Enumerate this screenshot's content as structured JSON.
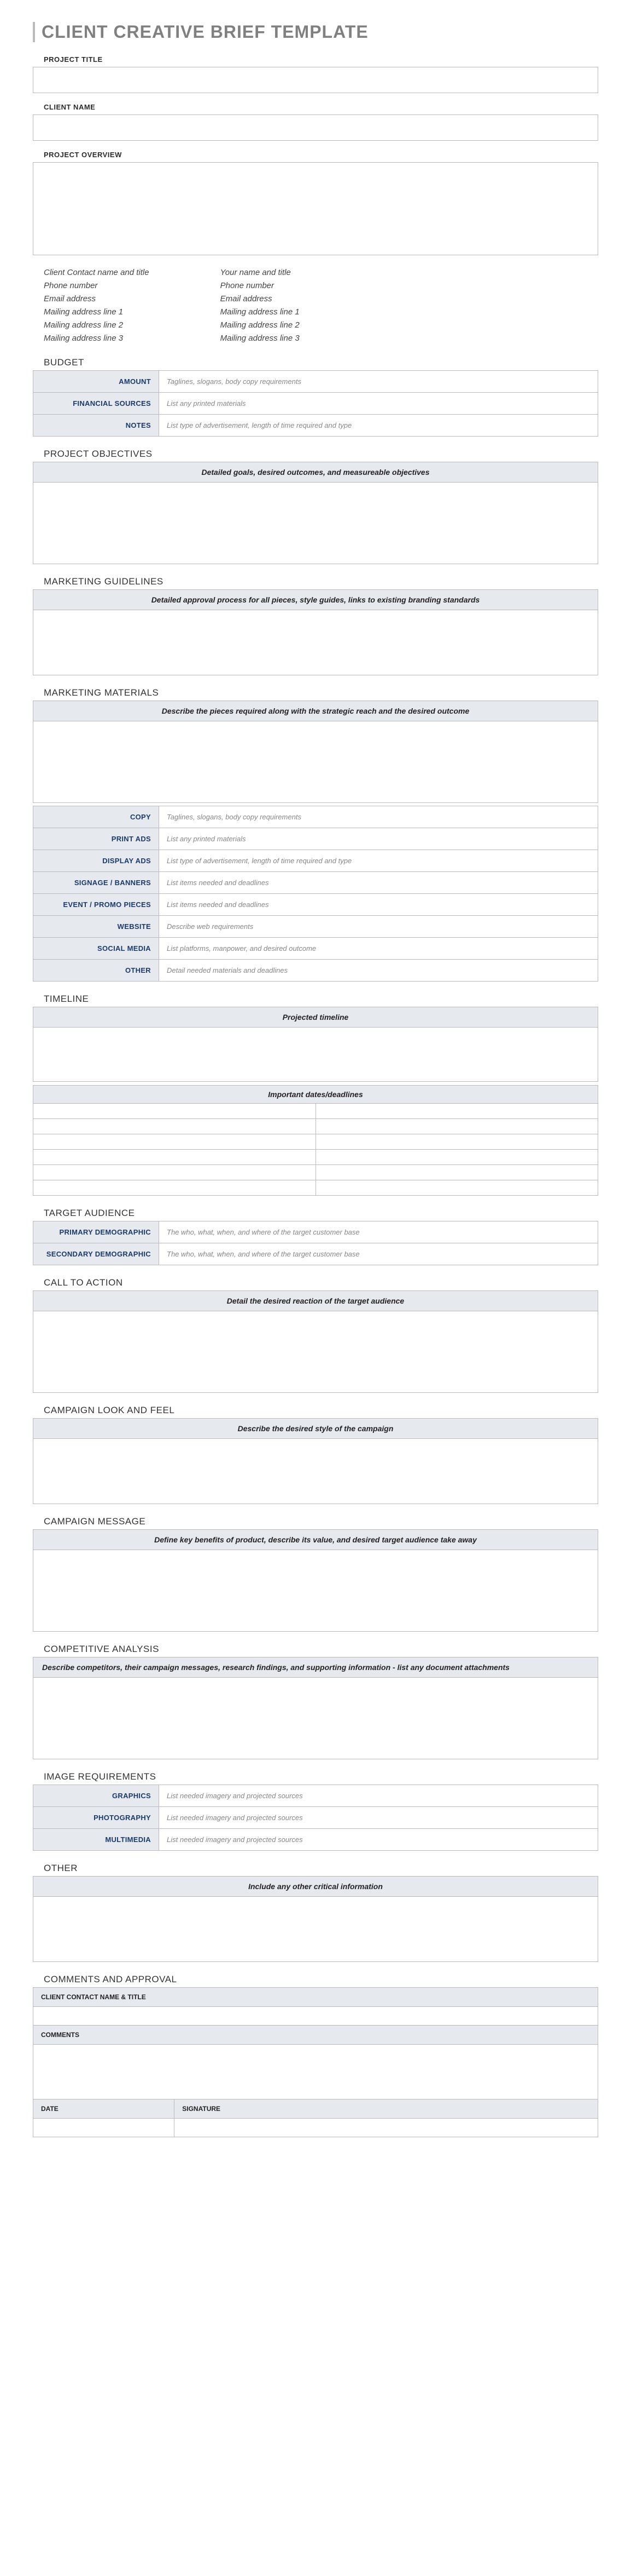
{
  "title": "CLIENT CREATIVE BRIEF TEMPLATE",
  "fields": {
    "project_title": "PROJECT TITLE",
    "client_name": "CLIENT NAME",
    "project_overview": "PROJECT OVERVIEW"
  },
  "contacts": {
    "client": [
      "Client Contact name and title",
      "Phone number",
      "Email address",
      "Mailing address line 1",
      "Mailing address line 2",
      "Mailing address line 3"
    ],
    "self": [
      "Your name and title",
      "Phone number",
      "Email address",
      "Mailing address line 1",
      "Mailing address line 2",
      "Mailing address line 3"
    ]
  },
  "budget": {
    "title": "BUDGET",
    "rows": [
      {
        "k": "AMOUNT",
        "v": "Taglines, slogans, body copy requirements"
      },
      {
        "k": "FINANCIAL SOURCES",
        "v": "List any printed materials"
      },
      {
        "k": "NOTES",
        "v": "List type of advertisement, length of time required and type"
      }
    ]
  },
  "objectives": {
    "title": "PROJECT OBJECTIVES",
    "prompt": "Detailed goals, desired outcomes, and measureable objectives"
  },
  "guidelines": {
    "title": "MARKETING GUIDELINES",
    "prompt": "Detailed approval process for all pieces, style guides, links to existing branding standards"
  },
  "materials": {
    "title": "MARKETING MATERIALS",
    "prompt": "Describe the pieces required along with the strategic reach and the desired outcome",
    "rows": [
      {
        "k": "COPY",
        "v": "Taglines, slogans, body copy requirements"
      },
      {
        "k": "PRINT ADS",
        "v": "List any printed materials"
      },
      {
        "k": "DISPLAY ADS",
        "v": "List type of advertisement, length of time required and type"
      },
      {
        "k": "SIGNAGE / BANNERS",
        "v": "List items needed and deadlines"
      },
      {
        "k": "EVENT / PROMO PIECES",
        "v": "List items needed and deadlines"
      },
      {
        "k": "WEBSITE",
        "v": "Describe web requirements"
      },
      {
        "k": "SOCIAL MEDIA",
        "v": "List platforms, manpower, and desired outcome"
      },
      {
        "k": "OTHER",
        "v": "Detail needed materials and deadlines"
      }
    ]
  },
  "timeline": {
    "title": "TIMELINE",
    "projected": "Projected timeline",
    "dates": "Important dates/deadlines"
  },
  "audience": {
    "title": "TARGET AUDIENCE",
    "rows": [
      {
        "k": "PRIMARY DEMOGRAPHIC",
        "v": "The who, what, when, and where of the target customer base"
      },
      {
        "k": "SECONDARY DEMOGRAPHIC",
        "v": "The who, what, when, and where of the target customer base"
      }
    ]
  },
  "cta": {
    "title": "CALL TO ACTION",
    "prompt": "Detail the desired reaction of the target audience"
  },
  "look": {
    "title": "CAMPAIGN LOOK AND FEEL",
    "prompt": "Describe the desired style of the campaign"
  },
  "message": {
    "title": "CAMPAIGN MESSAGE",
    "prompt": "Define key benefits of product, describe its value, and desired target audience take away"
  },
  "competitive": {
    "title": "COMPETITIVE ANALYSIS",
    "prompt": "Describe competitors, their campaign messages, research findings, and supporting information - list any document attachments"
  },
  "images": {
    "title": "IMAGE REQUIREMENTS",
    "rows": [
      {
        "k": "GRAPHICS",
        "v": "List needed imagery and projected sources"
      },
      {
        "k": "PHOTOGRAPHY",
        "v": "List needed imagery and projected sources"
      },
      {
        "k": "MULTIMEDIA",
        "v": "List needed imagery and projected sources"
      }
    ]
  },
  "other": {
    "title": "OTHER",
    "prompt": "Include any other critical information"
  },
  "approval": {
    "title": "COMMENTS AND APPROVAL",
    "name": "CLIENT CONTACT NAME & TITLE",
    "comments": "COMMENTS",
    "date": "DATE",
    "signature": "SIGNATURE"
  }
}
